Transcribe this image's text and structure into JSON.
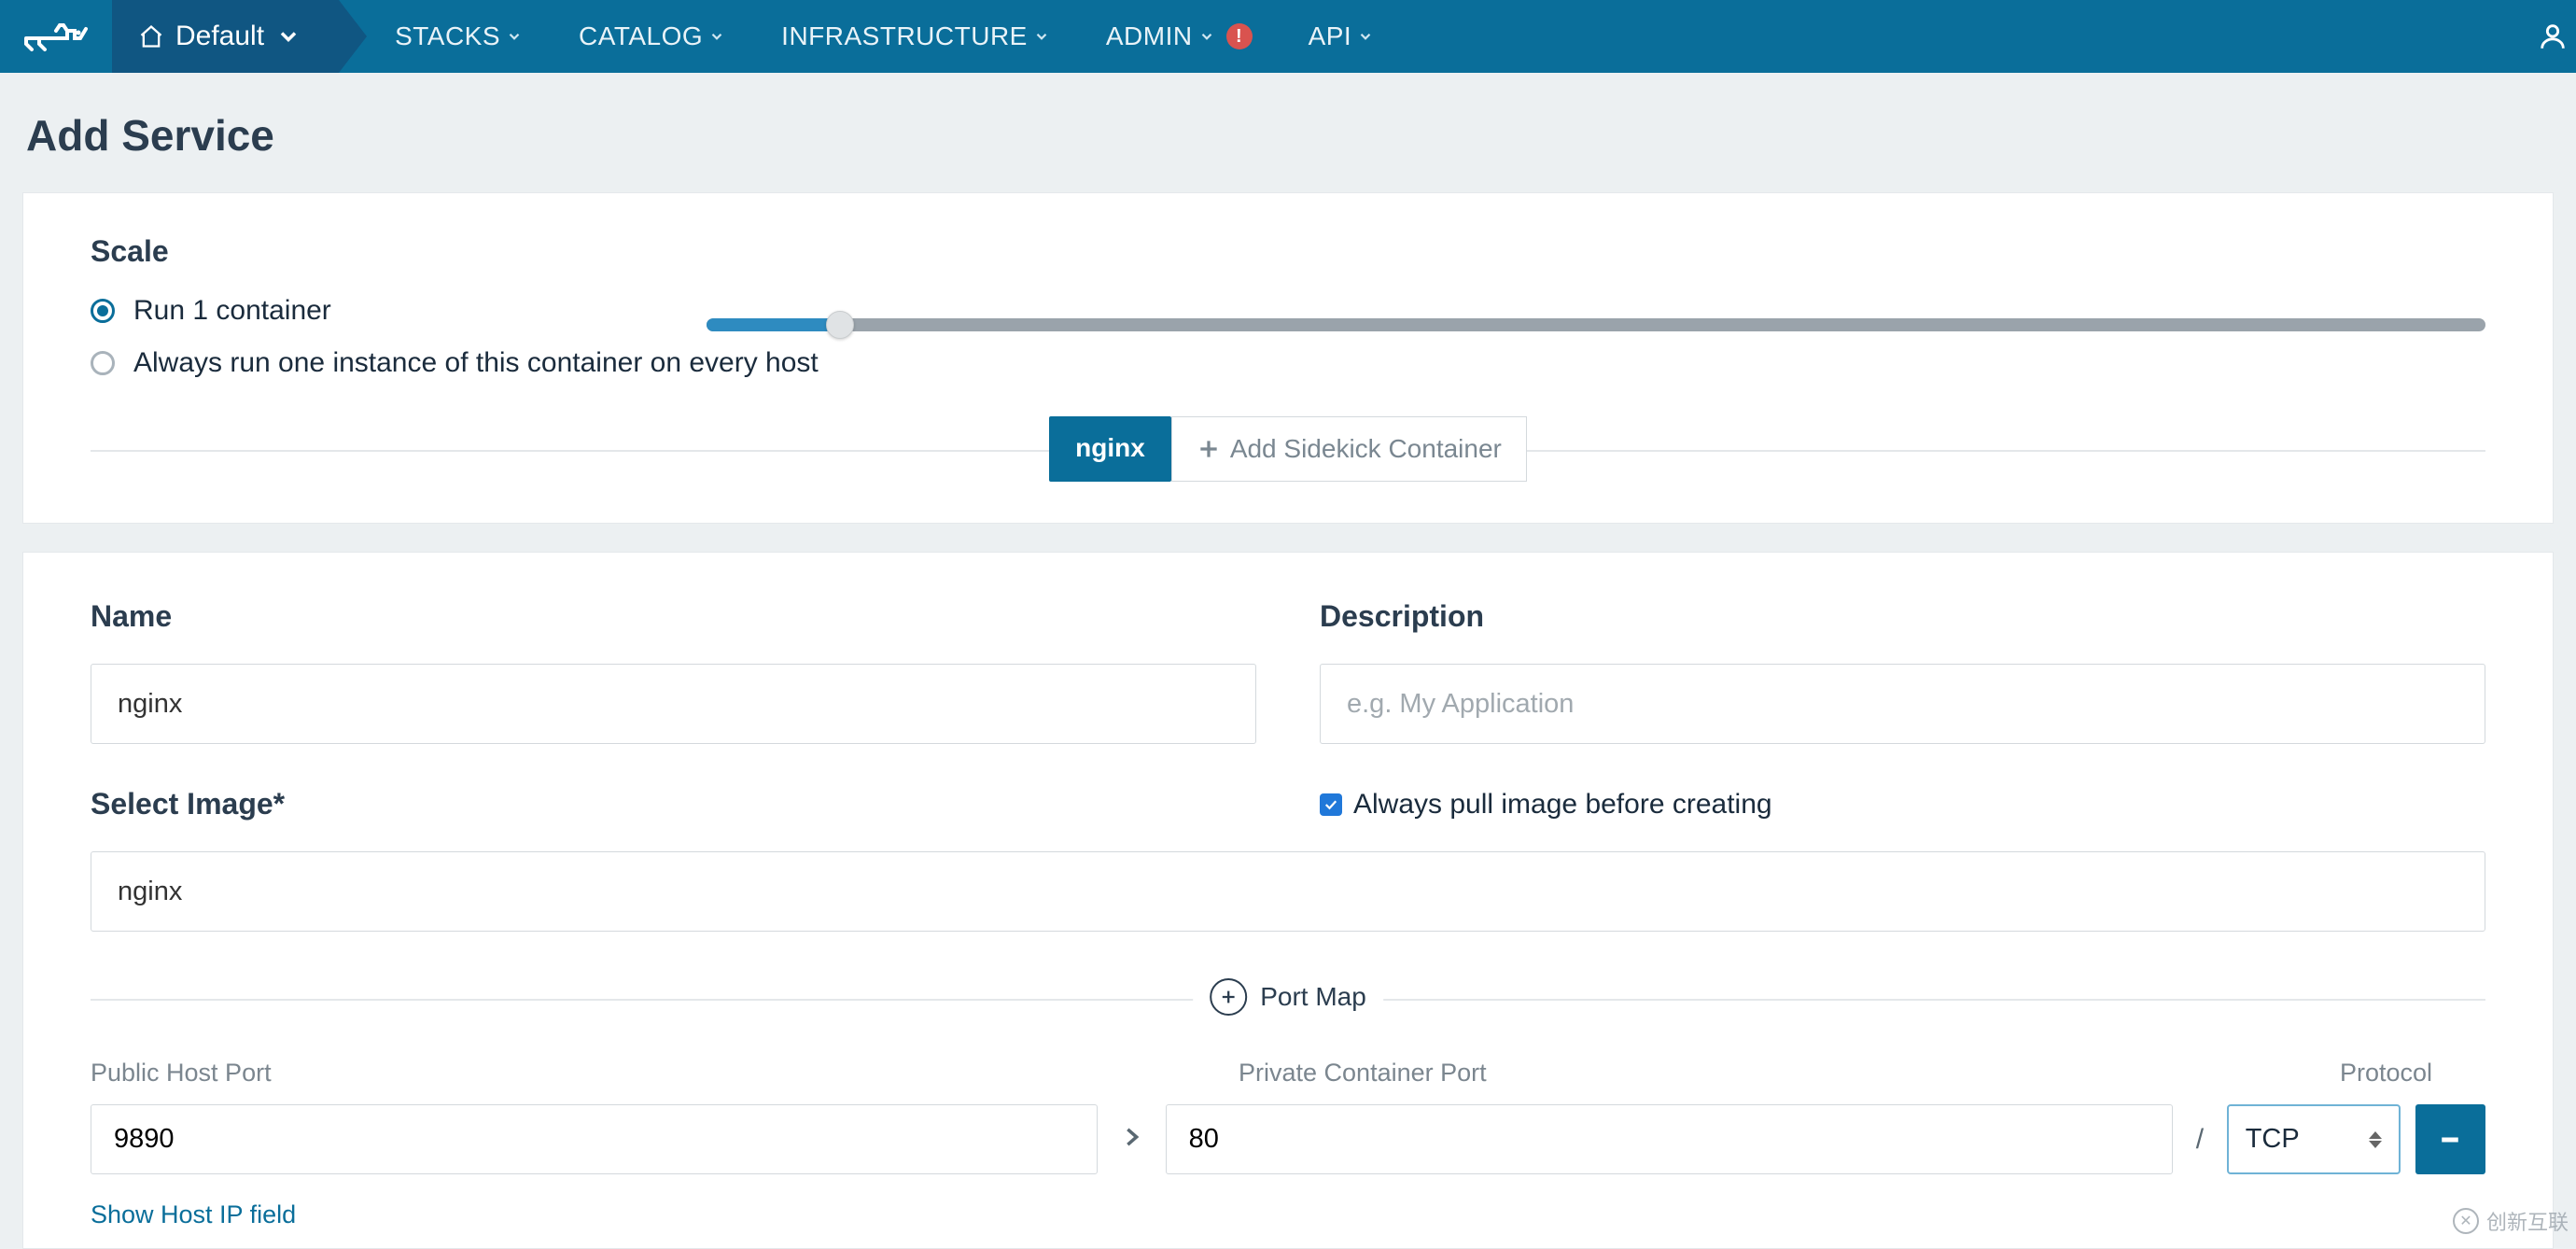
{
  "nav": {
    "env_label": "Default",
    "items": [
      "STACKS",
      "CATALOG",
      "INFRASTRUCTURE",
      "ADMIN",
      "API"
    ],
    "alert_on_index": 3,
    "alert_text": "!"
  },
  "page": {
    "title": "Add Service"
  },
  "scale": {
    "section_title": "Scale",
    "radio1": "Run 1 container",
    "radio2": "Always run one instance of this container on every host",
    "selected": 0
  },
  "tabs": {
    "active": "nginx",
    "add_sidekick": "Add Sidekick Container"
  },
  "form": {
    "name_label": "Name",
    "name_value": "nginx",
    "desc_label": "Description",
    "desc_placeholder": "e.g. My Application",
    "image_label": "Select Image*",
    "image_value": "nginx",
    "pull_label": "Always pull image before creating",
    "pull_checked": true
  },
  "portmap": {
    "header_label": "Port Map",
    "col_public": "Public Host Port",
    "col_private": "Private Container Port",
    "col_protocol": "Protocol",
    "row": {
      "public": "9890",
      "private": "80",
      "protocol": "TCP",
      "slash": "/"
    },
    "show_ip": "Show Host IP field"
  },
  "watermark": "创新互联"
}
